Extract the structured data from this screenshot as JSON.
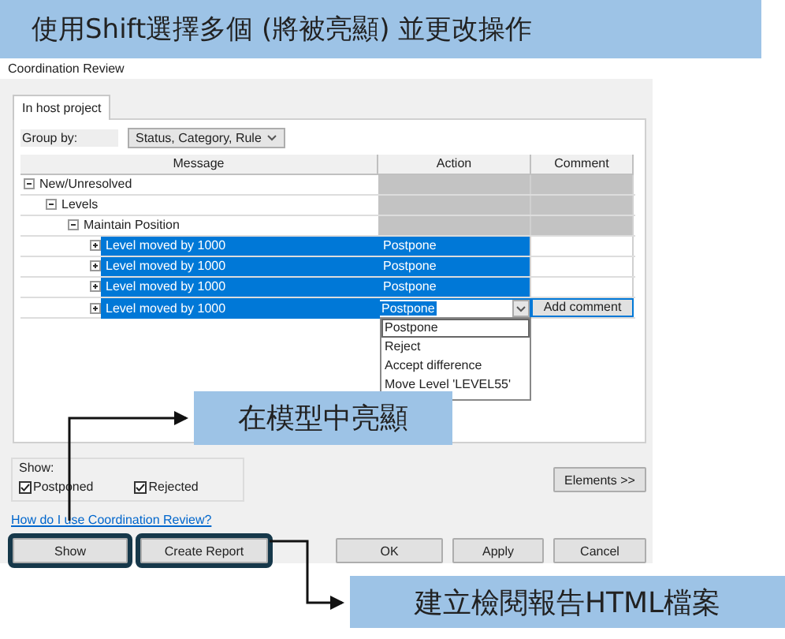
{
  "banner": {
    "text": "使用Shift選擇多個 (將被亮顯) 並更改操作"
  },
  "dialog": {
    "title": "Coordination Review"
  },
  "tabs": [
    {
      "label": "In host project",
      "selected": true
    }
  ],
  "group_by": {
    "label": "Group by:",
    "value": "Status, Category, Rule"
  },
  "table": {
    "columns": [
      "Message",
      "Action",
      "Comment"
    ],
    "rows": [
      {
        "kind": "group",
        "message": "New/Unresolved",
        "expanded": true,
        "children": [
          {
            "kind": "group",
            "message": "Levels",
            "expanded": true,
            "children": [
              {
                "kind": "group",
                "message": "Maintain Position",
                "expanded": true,
                "children": [
                  {
                    "kind": "issue",
                    "message": "Level moved by 1000",
                    "action": "Postpone",
                    "selected": true,
                    "expanded": false
                  },
                  {
                    "kind": "issue",
                    "message": "Level moved by 1000",
                    "action": "Postpone",
                    "selected": true,
                    "expanded": false
                  },
                  {
                    "kind": "issue",
                    "message": "Level moved by 1000",
                    "action": "Postpone",
                    "selected": true,
                    "expanded": false
                  },
                  {
                    "kind": "issue",
                    "message": "Level moved by 1000",
                    "action": "Postpone",
                    "selected": true,
                    "expanded": false,
                    "editing": true,
                    "comment_button": "Add comment",
                    "action_options": [
                      {
                        "label": "Postpone",
                        "selected": true
                      },
                      {
                        "label": "Reject",
                        "selected": false
                      },
                      {
                        "label": "Accept difference",
                        "selected": false
                      },
                      {
                        "label": "Move Level 'LEVEL55'",
                        "selected": false
                      }
                    ]
                  }
                ]
              }
            ]
          }
        ]
      }
    ]
  },
  "show": {
    "label": "Show:",
    "options": [
      {
        "label": "Postponed",
        "checked": true
      },
      {
        "label": "Rejected",
        "checked": true
      }
    ]
  },
  "elements_button": "Elements >>",
  "help_link": "How do I use Coordination Review?",
  "buttons_left": [
    {
      "label": "Show",
      "highlighted": true
    },
    {
      "label": "Create Report",
      "highlighted": true
    }
  ],
  "buttons_right": [
    {
      "label": "OK"
    },
    {
      "label": "Apply"
    },
    {
      "label": "Cancel"
    }
  ],
  "callouts": [
    {
      "text": "在模型中亮顯"
    },
    {
      "text": "建立檢閱報告HTML檔案"
    }
  ]
}
